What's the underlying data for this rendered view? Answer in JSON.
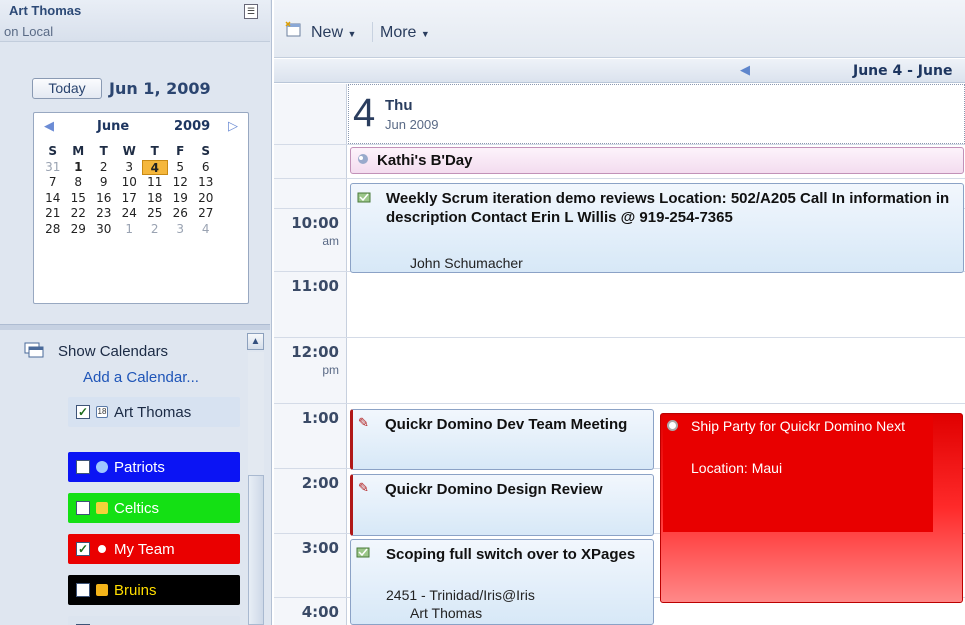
{
  "sidebar": {
    "owner_name": "Art Thomas",
    "owner_location": "on Local",
    "today_label": "Today",
    "today_date": "Jun 1, 2009",
    "minical": {
      "month": "June",
      "year": "2009",
      "dow": [
        "S",
        "M",
        "T",
        "W",
        "T",
        "F",
        "S"
      ],
      "weeks": [
        [
          "31",
          "1",
          "2",
          "3",
          "4",
          "5",
          "6"
        ],
        [
          "7",
          "8",
          "9",
          "10",
          "11",
          "12",
          "13"
        ],
        [
          "14",
          "15",
          "16",
          "17",
          "18",
          "19",
          "20"
        ],
        [
          "21",
          "22",
          "23",
          "24",
          "25",
          "26",
          "27"
        ],
        [
          "28",
          "29",
          "30",
          "1",
          "2",
          "3",
          "4"
        ]
      ],
      "selected_day": "4",
      "today_day": "1"
    },
    "show_calendars_label": "Show Calendars",
    "add_calendar_label": "Add a Calendar...",
    "calendars": [
      {
        "name": "Art Thomas",
        "checked": true,
        "color": "#d7e2f1"
      },
      {
        "name": "Patriots",
        "checked": false,
        "color": "#0b14f4"
      },
      {
        "name": "Celtics",
        "checked": false,
        "color": "#14e014"
      },
      {
        "name": "My Team",
        "checked": true,
        "color": "#ea0000"
      },
      {
        "name": "Bruins",
        "checked": false,
        "color": "#000000"
      }
    ]
  },
  "toolbar": {
    "new_label": "New",
    "more_label": "More"
  },
  "range_label": "June 4 - June",
  "day_header": {
    "day_number": "4",
    "day_name": "Thu",
    "month_year": "Jun 2009"
  },
  "times": [
    {
      "hour": "10:00",
      "ampm": "am"
    },
    {
      "hour": "11:00",
      "ampm": ""
    },
    {
      "hour": "12:00",
      "ampm": "pm"
    },
    {
      "hour": "1:00",
      "ampm": ""
    },
    {
      "hour": "2:00",
      "ampm": ""
    },
    {
      "hour": "3:00",
      "ampm": ""
    },
    {
      "hour": "4:00",
      "ampm": ""
    }
  ],
  "events": {
    "bday": {
      "title": "Kathi's B'Day"
    },
    "scrum": {
      "title": "Weekly Scrum iteration demo reviews Location: 502/A205 Call In information in description Contact Erin L Willis @ 919-254-7365",
      "chair": "John Schumacher"
    },
    "qdd": {
      "title": "Quickr Domino Dev Team Meeting"
    },
    "qdr": {
      "title": "Quickr Domino Design Review"
    },
    "scope": {
      "title": "Scoping full switch over to XPages",
      "location": "2451 - Trinidad/Iris@Iris",
      "chair": "Art Thomas"
    },
    "ship": {
      "title": "Ship Party for Quickr Domino Next",
      "location": "Location: Maui"
    }
  }
}
